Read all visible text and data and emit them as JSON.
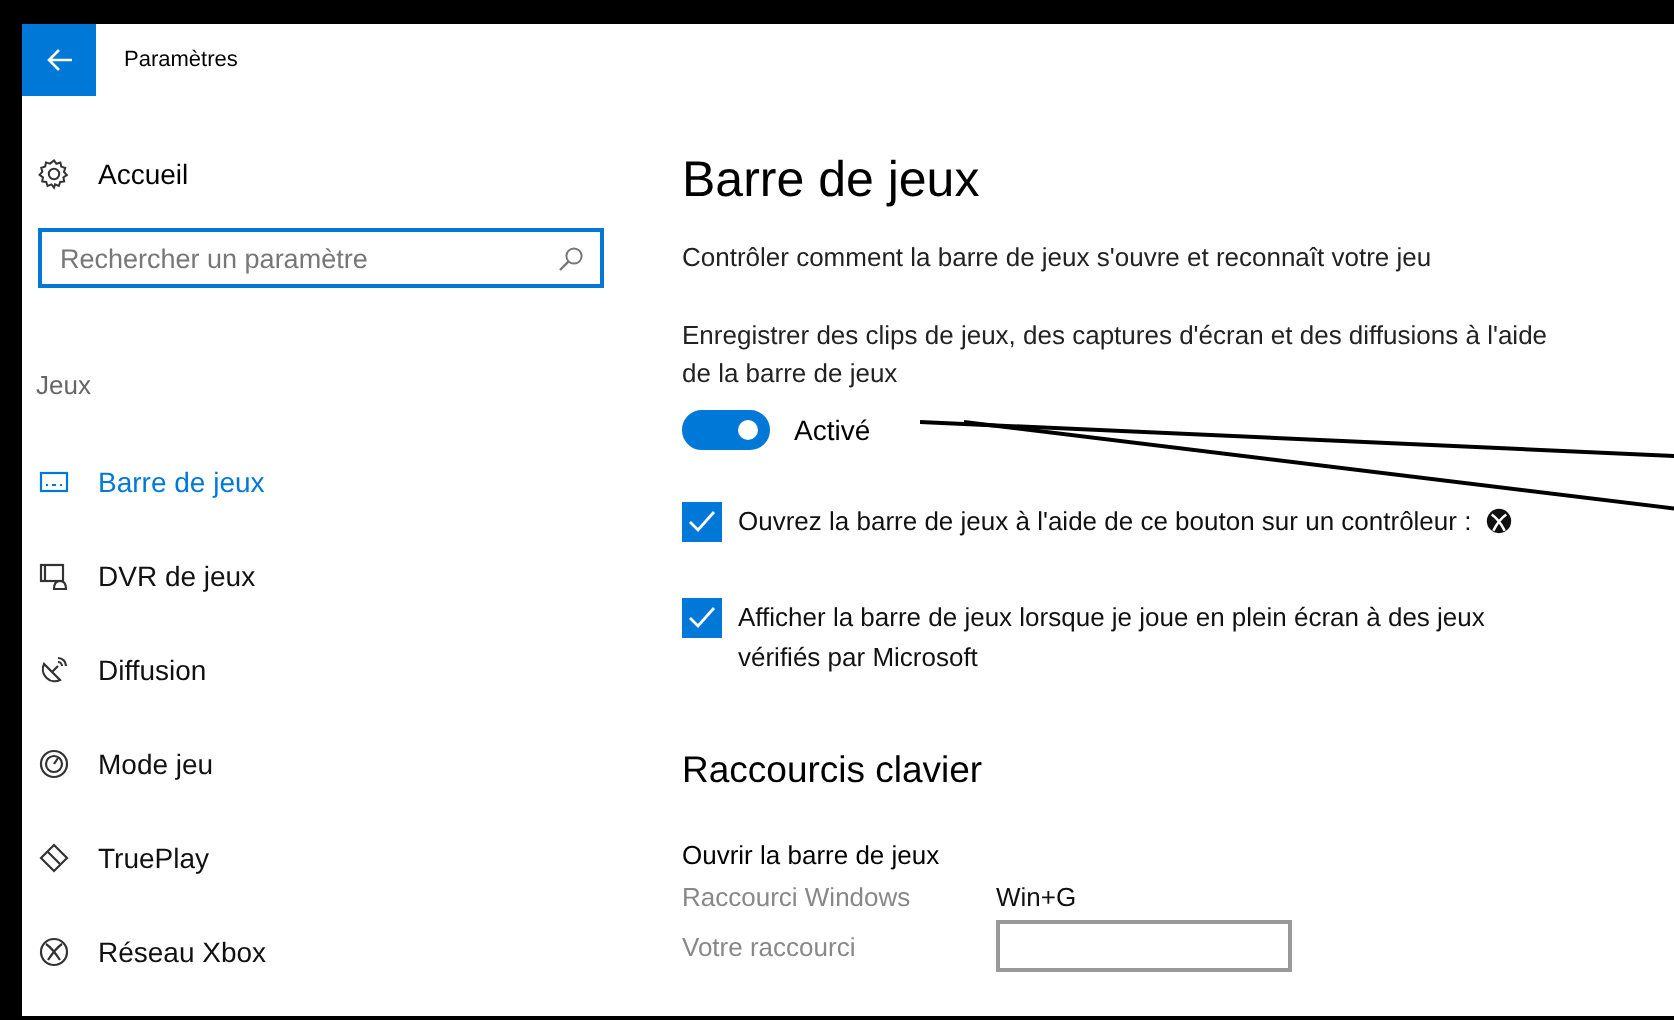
{
  "window": {
    "title": "Paramètres"
  },
  "sidebar": {
    "home": "Accueil",
    "search": {
      "placeholder": "Rechercher un paramètre"
    },
    "section": "Jeux",
    "items": [
      {
        "label": "Barre de jeux",
        "selected": true
      },
      {
        "label": "DVR de jeux",
        "selected": false
      },
      {
        "label": "Diffusion",
        "selected": false
      },
      {
        "label": "Mode jeu",
        "selected": false
      },
      {
        "label": "TruePlay",
        "selected": false
      },
      {
        "label": "Réseau Xbox",
        "selected": false
      }
    ]
  },
  "main": {
    "title": "Barre de jeux",
    "description": "Contrôler comment la barre de jeux s'ouvre et reconnaît votre jeu",
    "record_label": "Enregistrer des clips de jeux, des captures d'écran et des diffusions à l'aide de la barre de jeux",
    "toggle": {
      "on": true,
      "label": "Activé"
    },
    "checkboxes": [
      {
        "label": "Ouvrez la barre de jeux à l'aide de ce bouton sur un contrôleur :",
        "checked": true,
        "kind": "with-button-icon"
      },
      {
        "label": "Afficher la barre de jeux lorsque je joue en plein écran à des jeux vérifiés par Microsoft",
        "checked": true,
        "kind": "plain"
      }
    ],
    "shortcuts": {
      "heading": "Raccourcis clavier",
      "group": "Ouvrir la barre de jeux",
      "rows": [
        {
          "label": "Raccourci Windows",
          "value": "Win+G",
          "kind": "value"
        },
        {
          "label": "Votre raccourci",
          "kind": "field"
        }
      ]
    }
  }
}
